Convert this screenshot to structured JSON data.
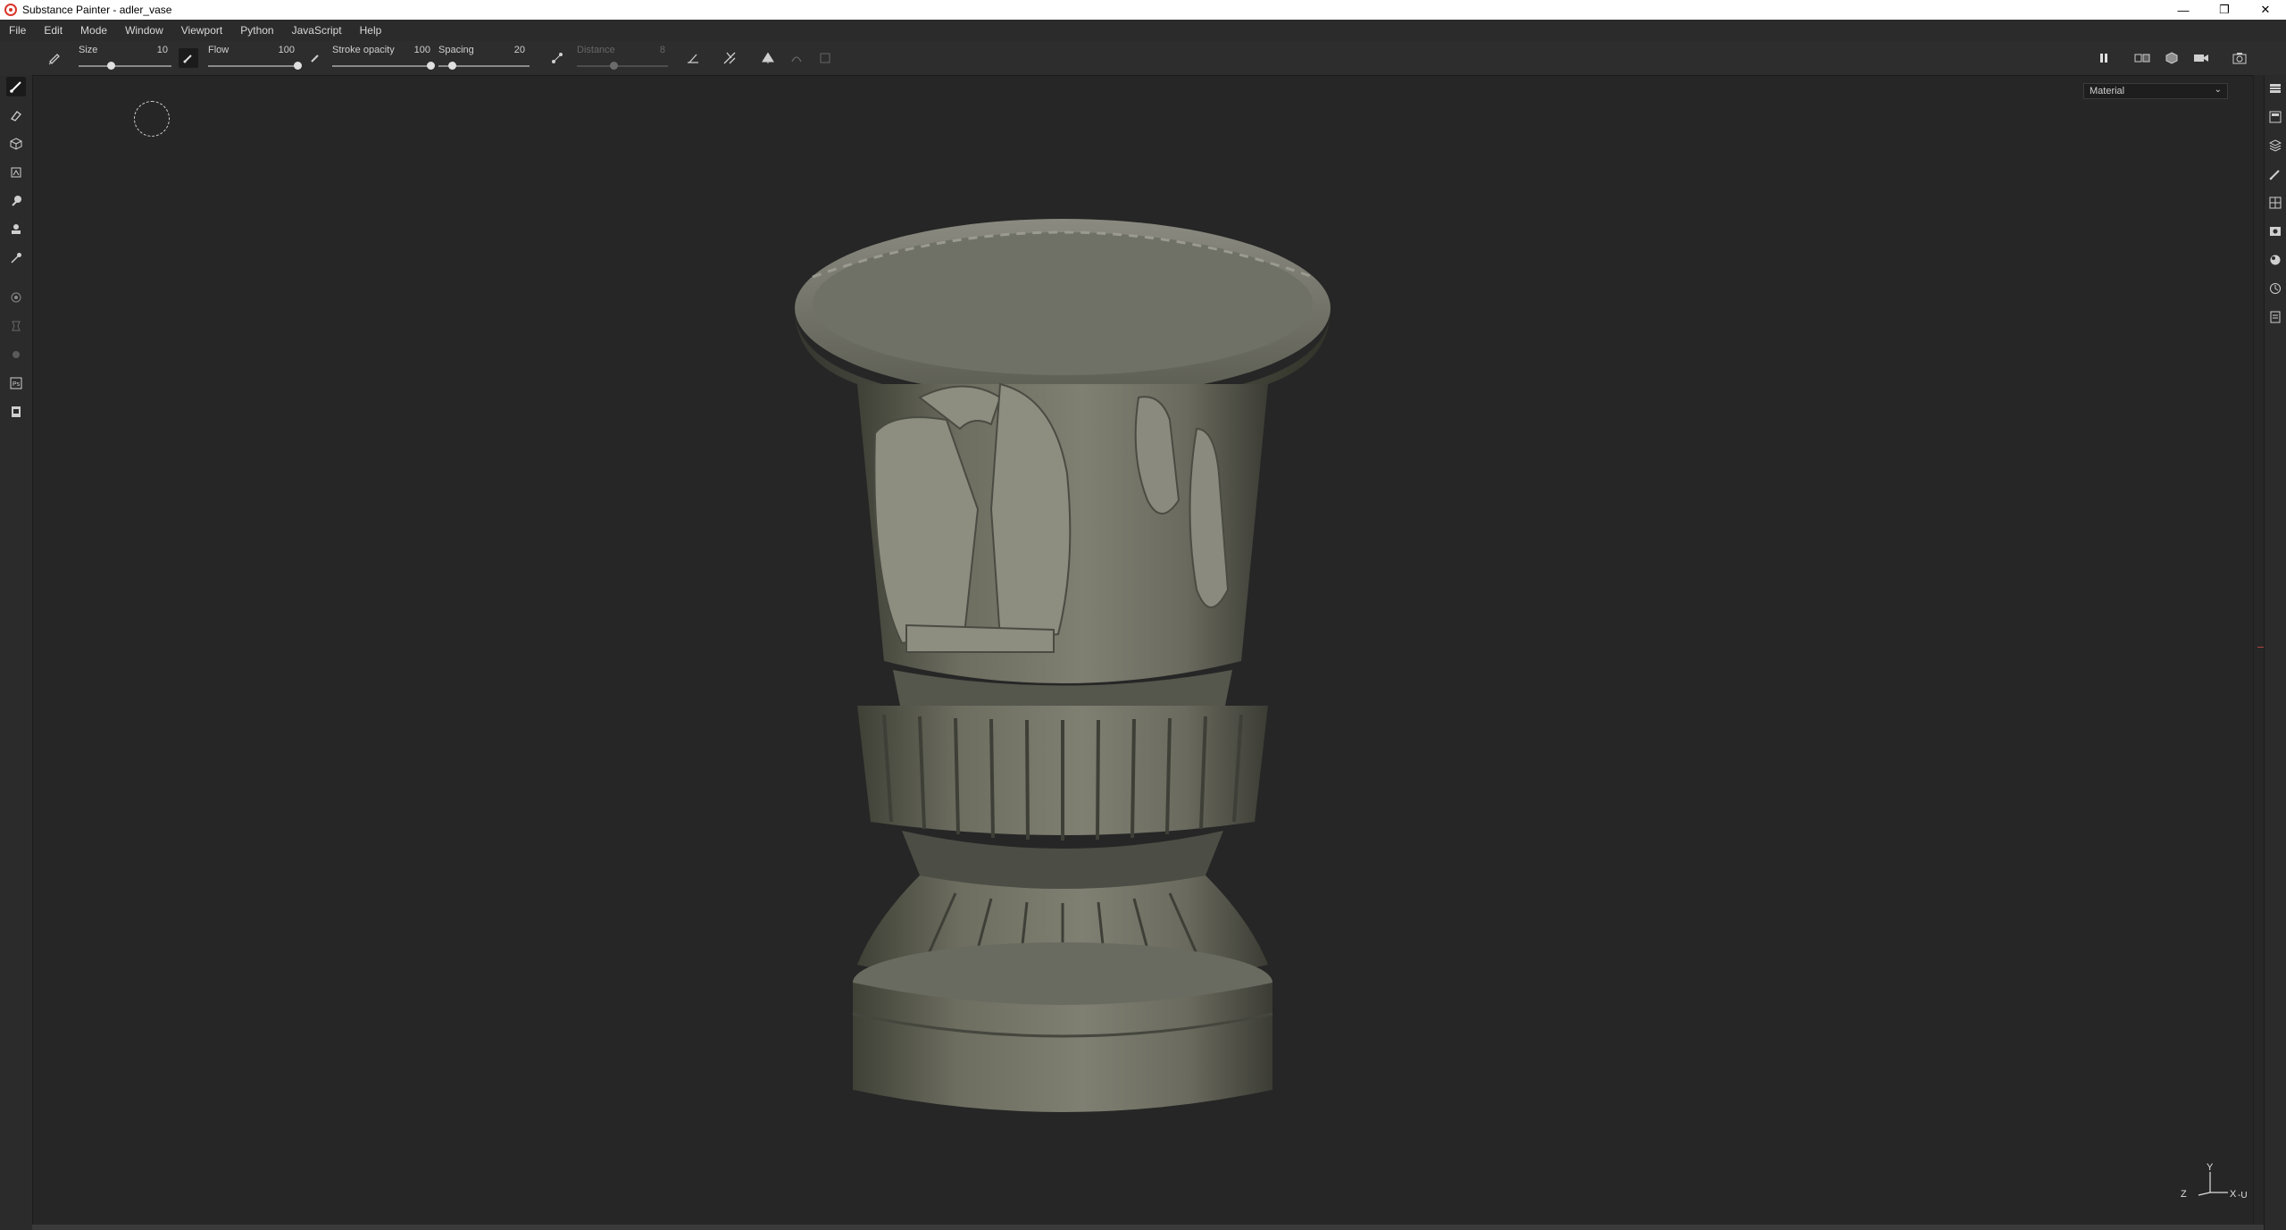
{
  "window": {
    "title": "Substance Painter - adler_vase",
    "controls": [
      "—",
      "❐",
      "✕"
    ]
  },
  "menu": [
    "File",
    "Edit",
    "Mode",
    "Window",
    "Viewport",
    "Python",
    "JavaScript",
    "Help"
  ],
  "toolbar": {
    "size": {
      "label": "Size",
      "value": "10",
      "fraction": 0.35
    },
    "flow": {
      "label": "Flow",
      "value": "100",
      "fraction": 1.0
    },
    "stroke_opacity": {
      "label": "Stroke opacity",
      "value": "100",
      "fraction": 1.0
    },
    "spacing": {
      "label": "Spacing",
      "value": "20",
      "fraction": 0.15
    },
    "distance": {
      "label": "Distance",
      "value": "8",
      "fraction": 0.4,
      "enabled": false
    }
  },
  "viewport": {
    "channel": "Material",
    "axis_labels": {
      "y": "Y",
      "z": "Z",
      "x": "X",
      "u": "-U"
    }
  },
  "left_tools": [
    "paint-brush-icon",
    "eraser-icon",
    "projection-icon",
    "geometry-decal-icon",
    "smudge-icon",
    "clone-icon",
    "color-picker-icon",
    "bake-icon",
    "fill-icon",
    "mask-icon",
    "photoshop-export-icon",
    "resource-icon"
  ],
  "right_tools": [
    "texture-set-list-icon",
    "texture-set-settings-icon",
    "layers-icon",
    "properties-icon",
    "display-settings-icon",
    "viewer-settings-icon",
    "shader-settings-icon",
    "history-icon",
    "log-icon"
  ]
}
